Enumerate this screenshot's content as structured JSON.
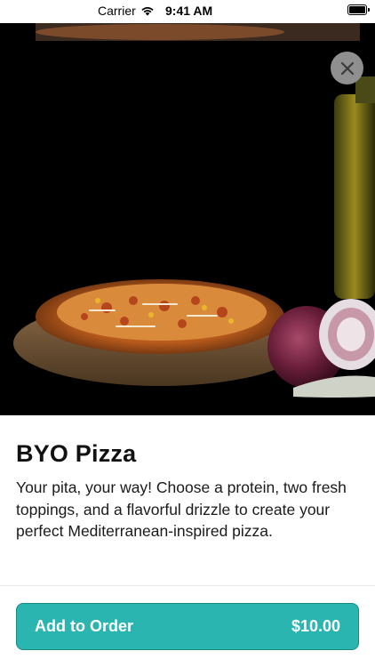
{
  "status_bar": {
    "carrier": "Carrier",
    "time": "9:41 AM"
  },
  "hero": {
    "image_alt": "pizza-on-wooden-board-with-onion-and-oil-bottle",
    "close_icon": "close-icon"
  },
  "product": {
    "title": "BYO Pizza",
    "description": "Your pita, your way! Choose a protein, two fresh toppings, and a flavorful drizzle to create your perfect Mediterranean-inspired pizza."
  },
  "footer": {
    "button_label": "Add to Order",
    "price": "$10.00"
  },
  "colors": {
    "accent": "#2bb5b0",
    "accent_border": "#1a8a86",
    "close_button": "#8f8f8f"
  }
}
